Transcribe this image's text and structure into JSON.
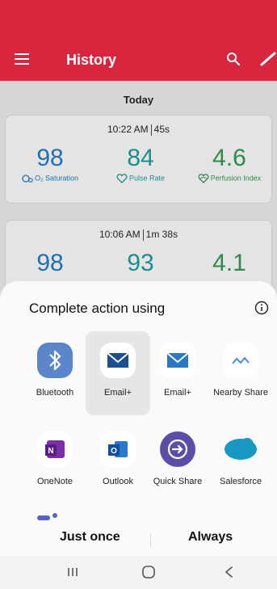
{
  "header": {
    "title": "History"
  },
  "history": {
    "day_label": "Today",
    "records": [
      {
        "time": "10:22 AM",
        "duration": "45s",
        "spo2": "98",
        "pulse": "84",
        "pi": "4.6",
        "spo2_label": "O₂ Saturation",
        "pulse_label": "Pulse Rate",
        "pi_label": "Perfusion Index"
      },
      {
        "time": "10:06 AM",
        "duration": "1m 38s",
        "spo2": "98",
        "pulse": "93",
        "pi": "4.1"
      }
    ]
  },
  "share_sheet": {
    "title": "Complete action using",
    "apps": [
      {
        "label": "Bluetooth",
        "icon": "bluetooth-icon"
      },
      {
        "label": "Email+",
        "icon": "email-icon"
      },
      {
        "label": "Email+",
        "icon": "email-icon"
      },
      {
        "label": "Nearby Share",
        "icon": "nearby-share-icon"
      },
      {
        "label": "OneNote",
        "icon": "onenote-icon"
      },
      {
        "label": "Outlook",
        "icon": "outlook-icon"
      },
      {
        "label": "Quick Share",
        "icon": "quick-share-icon"
      },
      {
        "label": "Salesforce",
        "icon": "salesforce-icon"
      }
    ],
    "just_once": "Just once",
    "always": "Always"
  },
  "colors": {
    "brand": "#d7263d",
    "spo2": "#1f6fb5",
    "pulse": "#1b8e8e",
    "pi": "#2e8b4a"
  }
}
